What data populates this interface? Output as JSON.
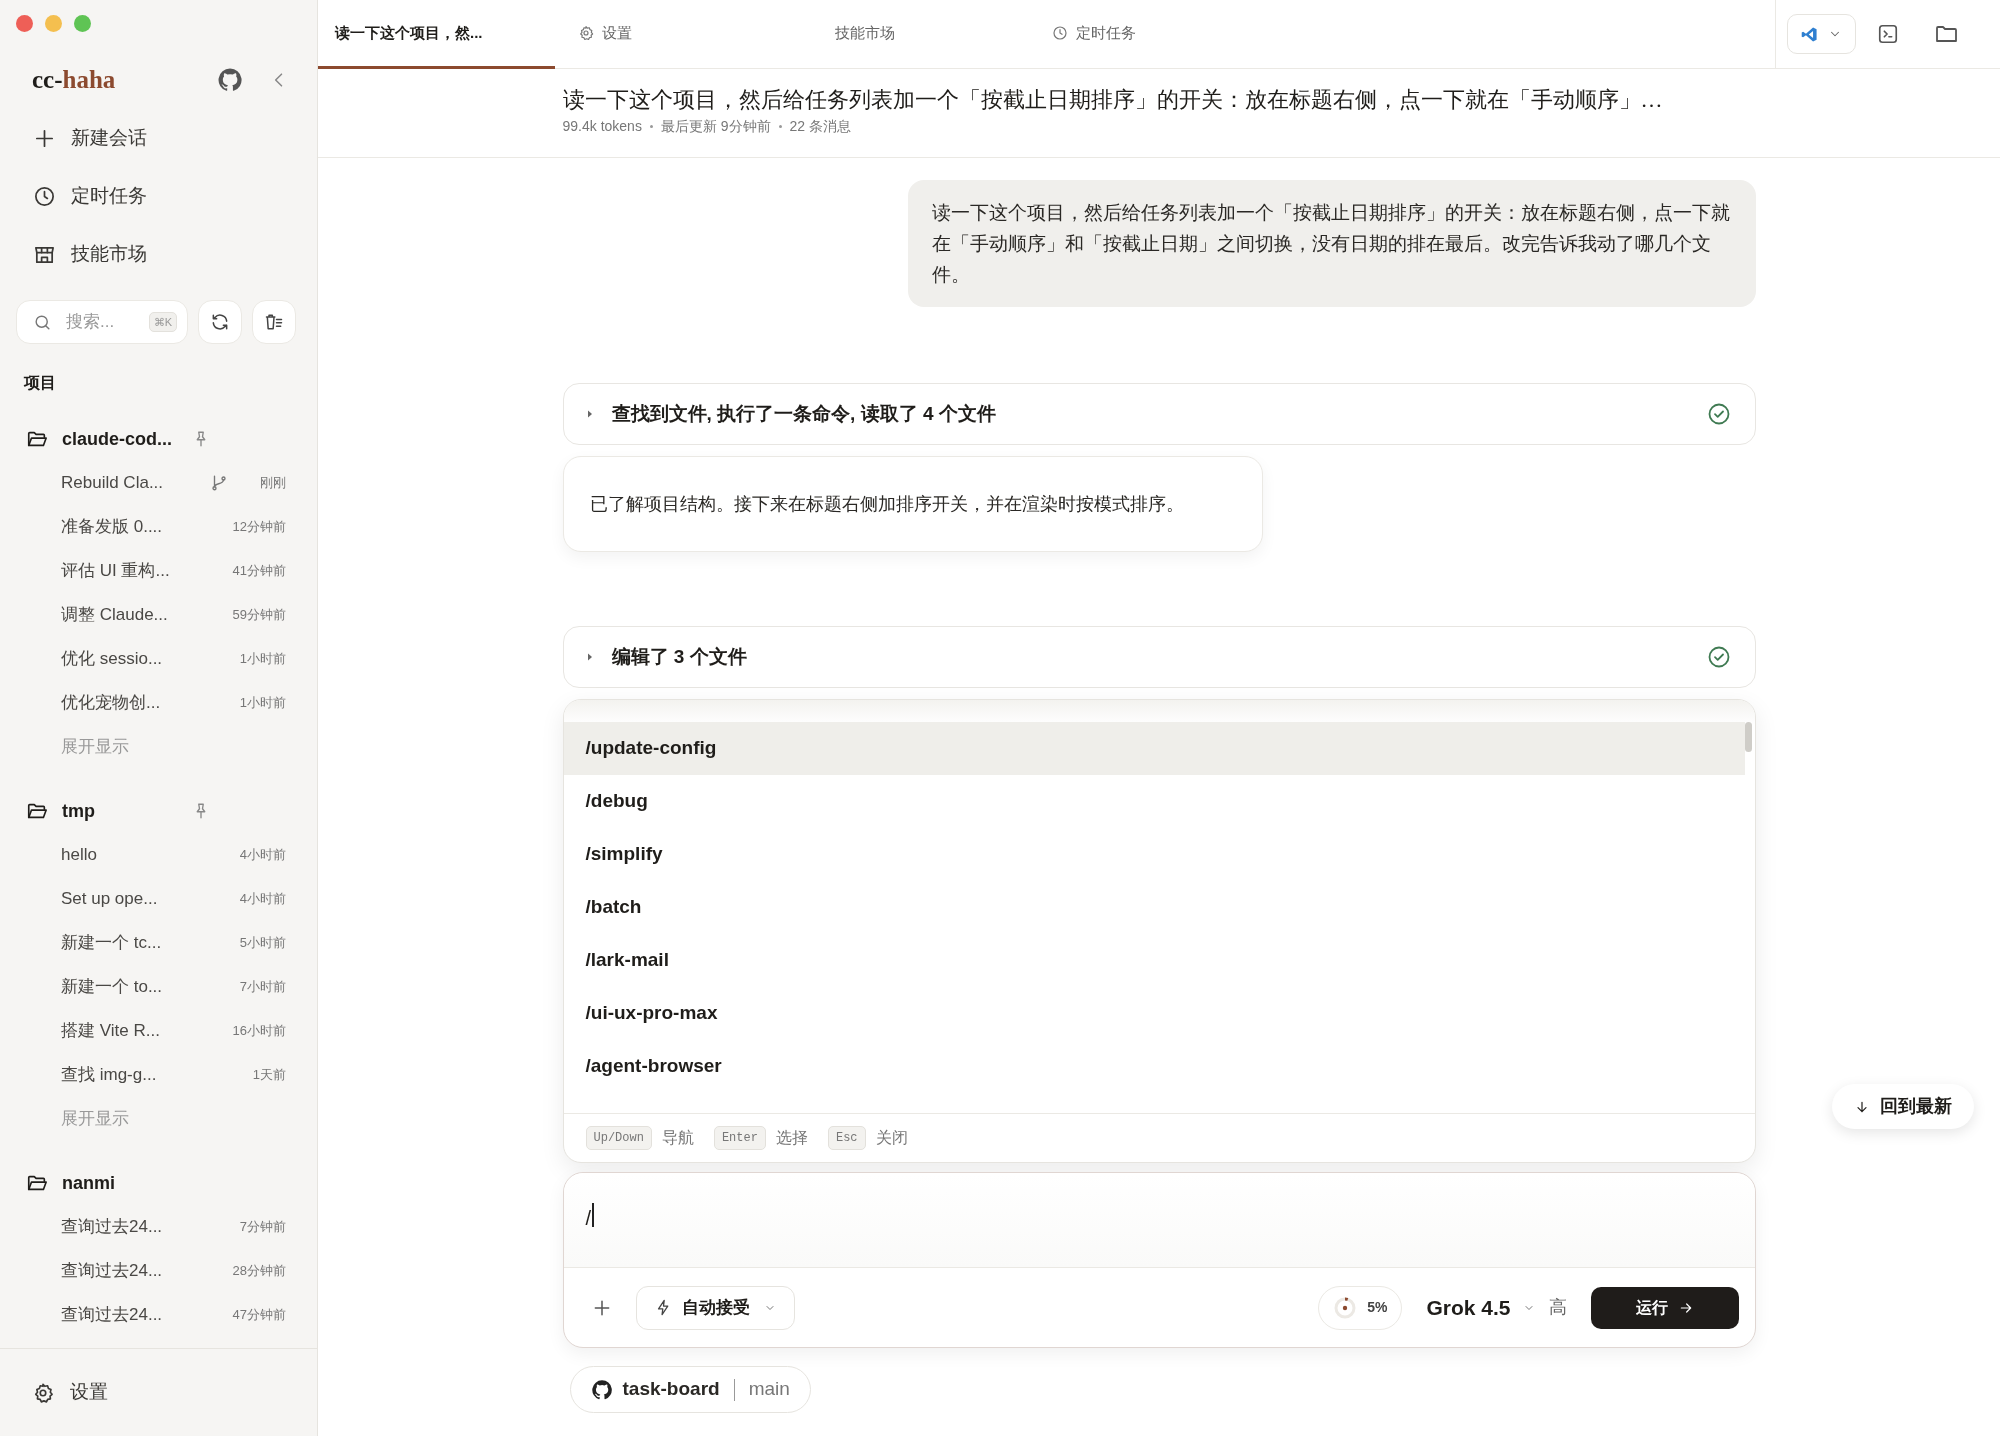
{
  "sidebar": {
    "brand": {
      "lead": "cc-",
      "accent": "haha"
    },
    "nav": [
      {
        "kind": "new",
        "label": "新建会话"
      },
      {
        "kind": "schedule",
        "label": "定时任务"
      },
      {
        "kind": "market",
        "label": "技能市场"
      }
    ],
    "search": {
      "placeholder": "搜索...",
      "shortcut": "⌘K"
    },
    "section_label": "项目",
    "projects": [
      {
        "name": "claude-cod...",
        "pinned": true,
        "more": "展开显示",
        "sessions": [
          {
            "title": "Rebuild Cla...",
            "time": "刚刚",
            "branched": true
          },
          {
            "title": "准备发版 0....",
            "time": "12分钟前",
            "branched": false
          },
          {
            "title": "评估 UI 重构...",
            "time": "41分钟前",
            "branched": false
          },
          {
            "title": "调整 Claude...",
            "time": "59分钟前",
            "branched": false
          },
          {
            "title": "优化 sessio...",
            "time": "1小时前",
            "branched": false
          },
          {
            "title": "优化宠物创...",
            "time": "1小时前",
            "branched": false
          }
        ]
      },
      {
        "name": "tmp",
        "pinned": true,
        "more": "展开显示",
        "sessions": [
          {
            "title": "hello",
            "time": "4小时前",
            "branched": false
          },
          {
            "title": "Set up ope...",
            "time": "4小时前",
            "branched": false
          },
          {
            "title": "新建一个 tc...",
            "time": "5小时前",
            "branched": false
          },
          {
            "title": "新建一个 to...",
            "time": "7小时前",
            "branched": false
          },
          {
            "title": "搭建 Vite R...",
            "time": "16小时前",
            "branched": false
          },
          {
            "title": "查找 img-g...",
            "time": "1天前",
            "branched": false
          }
        ]
      },
      {
        "name": "nanmi",
        "pinned": false,
        "sessions": [
          {
            "title": "查询过去24...",
            "time": "7分钟前",
            "branched": false
          },
          {
            "title": "查询过去24...",
            "time": "28分钟前",
            "branched": false
          },
          {
            "title": "查询过去24...",
            "time": "47分钟前",
            "branched": false
          }
        ]
      }
    ],
    "settings": "设置"
  },
  "tabs": [
    {
      "kind": "session",
      "label": "读一下这个项目，然...",
      "selected": true
    },
    {
      "kind": "settings",
      "label": "设置",
      "selected": false
    },
    {
      "kind": "market",
      "label": "技能市场",
      "selected": false
    },
    {
      "kind": "schedule",
      "label": "定时任务",
      "selected": false
    }
  ],
  "header": {
    "title": "读一下这个项目，然后给任务列表加一个「按截止日期排序」的开关：放在标题右侧，点一下就在「手动顺序」…",
    "meta": [
      "99.4k tokens",
      "最后更新 9分钟前",
      "22 条消息"
    ]
  },
  "messages": [
    {
      "kind": "user",
      "text": "读一下这个项目，然后给任务列表加一个「按截止日期排序」的开关：放在标题右侧，点一下就在「手动顺序」和「按截止日期」之间切换，没有日期的排在最后。改完告诉我动了哪几个文件。"
    },
    {
      "kind": "tool",
      "text": "查找到文件, 执行了一条命令, 读取了 4 个文件",
      "done": true
    },
    {
      "kind": "assistant",
      "text": "已了解项目结构。接下来在标题右侧加排序开关，并在渲染时按模式排序。"
    },
    {
      "kind": "tool",
      "text": "编辑了 3 个文件",
      "done": true
    }
  ],
  "command_menu": {
    "items": [
      {
        "label": "/update-config",
        "selected": true
      },
      {
        "label": "/debug",
        "selected": false
      },
      {
        "label": "/simplify",
        "selected": false
      },
      {
        "label": "/batch",
        "selected": false
      },
      {
        "label": "/lark-mail",
        "selected": false
      },
      {
        "label": "/ui-ux-pro-max",
        "selected": false
      },
      {
        "label": "/agent-browser",
        "selected": false
      }
    ],
    "hints": [
      {
        "key": "Up/Down",
        "label": "导航"
      },
      {
        "key": "Enter",
        "label": "选择"
      },
      {
        "key": "Esc",
        "label": "关闭"
      }
    ]
  },
  "composer": {
    "value": "/",
    "mode": "自动接受",
    "context": {
      "level": 0.05,
      "reading": "5%"
    },
    "model": "Grok 4.5",
    "effort": "高",
    "submit": "运行"
  },
  "repo": {
    "name": "task-board",
    "branch": "main"
  },
  "jump_latest": "回到最新"
}
